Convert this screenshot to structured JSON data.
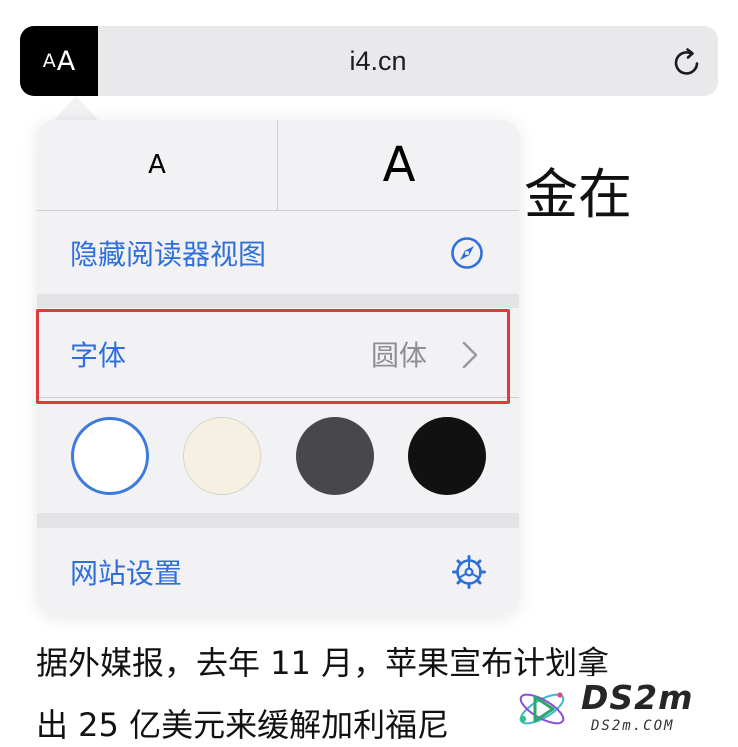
{
  "address_bar": {
    "aa_small": "A",
    "aa_large": "A",
    "url": "i4.cn"
  },
  "background": {
    "heading_fragment": "金在",
    "article_lines": [
      "据外媒报，去年 11 月，苹果宣布计划拿",
      "出 25 亿美元来缓解加利福尼"
    ]
  },
  "popover": {
    "font_smaller_label": "A",
    "font_larger_label": "A",
    "hide_reader_label": "隐藏阅读器视图",
    "font_label": "字体",
    "font_value": "圆体",
    "themes": [
      "white",
      "sepia",
      "gray",
      "black"
    ],
    "website_settings_label": "网站设置",
    "icons": {
      "hide_reader": "compass-icon",
      "font": "chevron-right-icon",
      "settings": "gear-icon",
      "reload": "reload-icon"
    }
  },
  "colors": {
    "accent_blue": "#2f6fdc",
    "highlight_red": "#e03a3a",
    "popover_bg": "#f2f2f4"
  },
  "watermark": {
    "title": "DS2m",
    "subtitle": "DS2m.COM"
  }
}
